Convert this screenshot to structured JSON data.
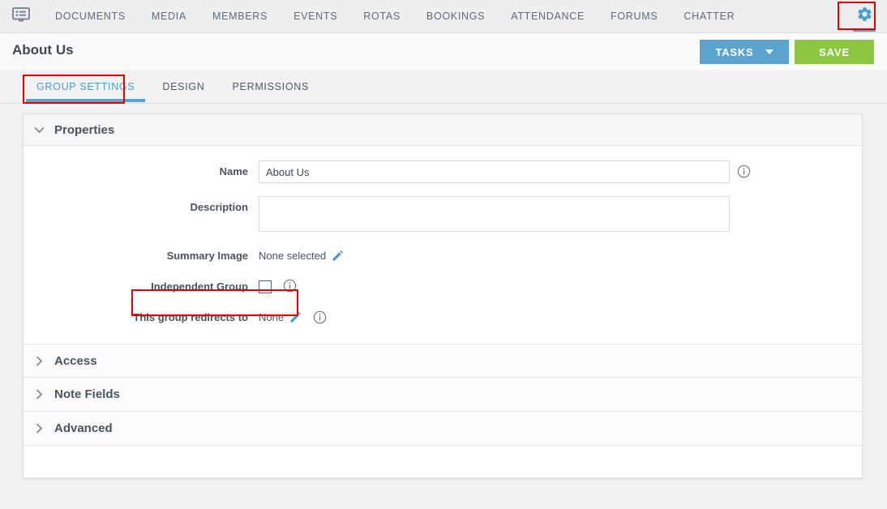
{
  "topnav": {
    "home_icon": "dashboard-icon",
    "items": [
      {
        "label": "DOCUMENTS"
      },
      {
        "label": "MEDIA"
      },
      {
        "label": "MEMBERS"
      },
      {
        "label": "EVENTS"
      },
      {
        "label": "ROTAS"
      },
      {
        "label": "BOOKINGS"
      },
      {
        "label": "ATTENDANCE"
      },
      {
        "label": "FORUMS"
      },
      {
        "label": "CHATTER"
      }
    ],
    "gear_icon": "gear-icon",
    "accent_color": "#4a9ec8"
  },
  "header": {
    "title": "About Us",
    "tasks_label": "TASKS",
    "save_label": "SAVE",
    "tasks_color": "#5ba4cf",
    "save_color": "#8dc63f"
  },
  "tabs": [
    {
      "label": "GROUP SETTINGS",
      "active": true
    },
    {
      "label": "DESIGN",
      "active": false
    },
    {
      "label": "PERMISSIONS",
      "active": false
    }
  ],
  "sections": {
    "properties": {
      "title": "Properties",
      "expanded": true,
      "fields": {
        "name": {
          "label": "Name",
          "value": "About Us",
          "placeholder": ""
        },
        "description": {
          "label": "Description",
          "value": "",
          "placeholder": ""
        },
        "summary_image": {
          "label": "Summary Image",
          "value": "None selected"
        },
        "independent_group": {
          "label": "Independent Group",
          "checked": false
        },
        "redirect": {
          "label": "This group redirects to",
          "value": "None"
        }
      }
    },
    "access": {
      "title": "Access",
      "expanded": false
    },
    "note_fields": {
      "title": "Note Fields",
      "expanded": false
    },
    "advanced": {
      "title": "Advanced",
      "expanded": false
    }
  },
  "annotations": {
    "color": "#e60000",
    "boxes": [
      "gear-icon",
      "group-settings-tab",
      "independent-group-row"
    ]
  }
}
